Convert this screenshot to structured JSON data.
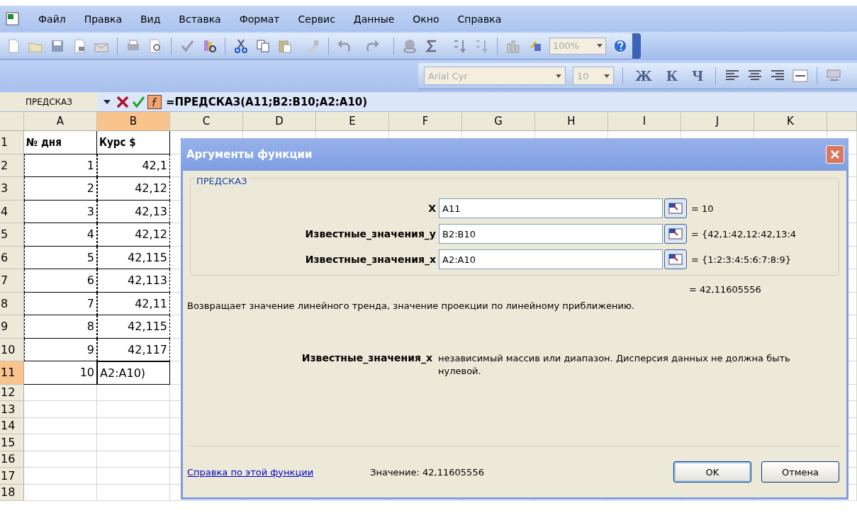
{
  "menu": [
    {
      "label": "Файл"
    },
    {
      "label": "Правка"
    },
    {
      "label": "Вид"
    },
    {
      "label": "Вставка"
    },
    {
      "label": "Формат"
    },
    {
      "label": "Сервис"
    },
    {
      "label": "Данные"
    },
    {
      "label": "Окно"
    },
    {
      "label": "Справка"
    }
  ],
  "standard_toolbar": {
    "zoom": "100%"
  },
  "format_toolbar": {
    "font": "Arial Cyr",
    "size": "10",
    "style_buttons": [
      "Ж",
      "К",
      "Ч"
    ]
  },
  "formula_bar": {
    "name_box": "ПРЕДСКАЗ",
    "formula": "=ПРЕДСКАЗ(A11;B2:B10;A2:A10)"
  },
  "sheet": {
    "columns": [
      {
        "label": "A",
        "selected": false
      },
      {
        "label": "B",
        "selected": true
      },
      {
        "label": "C",
        "selected": false
      },
      {
        "label": "D",
        "selected": false
      },
      {
        "label": "E",
        "selected": false
      },
      {
        "label": "F",
        "selected": false
      },
      {
        "label": "G",
        "selected": false
      },
      {
        "label": "H",
        "selected": false
      },
      {
        "label": "I",
        "selected": false
      },
      {
        "label": "J",
        "selected": false
      },
      {
        "label": "K",
        "selected": false
      }
    ],
    "rows": [
      {
        "header": "1",
        "selected": false,
        "in_range": false,
        "editing": false,
        "cells": [
          "№ дня",
          "Курс $"
        ]
      },
      {
        "header": "2",
        "selected": false,
        "in_range": true,
        "editing": false,
        "cells": [
          "1",
          "42,1"
        ]
      },
      {
        "header": "3",
        "selected": false,
        "in_range": true,
        "editing": false,
        "cells": [
          "2",
          "42,12"
        ]
      },
      {
        "header": "4",
        "selected": false,
        "in_range": true,
        "editing": false,
        "cells": [
          "3",
          "42,13"
        ]
      },
      {
        "header": "5",
        "selected": false,
        "in_range": true,
        "editing": false,
        "cells": [
          "4",
          "42,12"
        ]
      },
      {
        "header": "6",
        "selected": false,
        "in_range": true,
        "editing": false,
        "cells": [
          "5",
          "42,115"
        ]
      },
      {
        "header": "7",
        "selected": false,
        "in_range": true,
        "editing": false,
        "cells": [
          "6",
          "42,113"
        ]
      },
      {
        "header": "8",
        "selected": false,
        "in_range": true,
        "editing": false,
        "cells": [
          "7",
          "42,11"
        ]
      },
      {
        "header": "9",
        "selected": false,
        "in_range": true,
        "editing": false,
        "cells": [
          "8",
          "42,115"
        ]
      },
      {
        "header": "10",
        "selected": false,
        "in_range": true,
        "editing": false,
        "cells": [
          "9",
          "42,117"
        ]
      },
      {
        "header": "11",
        "selected": true,
        "in_range": false,
        "editing": true,
        "cells": [
          "10",
          "A2:A10)"
        ]
      },
      {
        "header": "12",
        "selected": false,
        "in_range": false,
        "editing": false,
        "cells": []
      },
      {
        "header": "13",
        "selected": false,
        "in_range": false,
        "editing": false,
        "cells": []
      },
      {
        "header": "14",
        "selected": false,
        "in_range": false,
        "editing": false,
        "cells": []
      },
      {
        "header": "15",
        "selected": false,
        "in_range": false,
        "editing": false,
        "cells": []
      },
      {
        "header": "16",
        "selected": false,
        "in_range": false,
        "editing": false,
        "cells": []
      },
      {
        "header": "17",
        "selected": false,
        "in_range": false,
        "editing": false,
        "cells": []
      },
      {
        "header": "18",
        "selected": false,
        "in_range": false,
        "editing": false,
        "cells": []
      }
    ]
  },
  "dialog": {
    "title": "Аргументы функции",
    "function_name": "ПРЕДСКАЗ",
    "arguments": [
      {
        "label": "X",
        "value": "A11",
        "result": "= 10"
      },
      {
        "label": "Известные_значения_y",
        "value": "B2:B10",
        "result": "= {42,1:42,12:42,13:4"
      },
      {
        "label": "Известные_значения_x",
        "value": "A2:A10",
        "result": "= {1:2:3:4:5:6:7:8:9}"
      }
    ],
    "result": "= 42,11605556",
    "description": "Возвращает значение линейного тренда, значение проекции по линейному приближению.",
    "argument_help": {
      "label": "Известные_значения_x",
      "text": "независимый массив или диапазон. Дисперсия данных не должна быть нулевой."
    },
    "help_link": "Справка по этой функции",
    "value": "Значение: 42,11605556",
    "buttons": [
      "OK",
      "Отмена"
    ]
  }
}
